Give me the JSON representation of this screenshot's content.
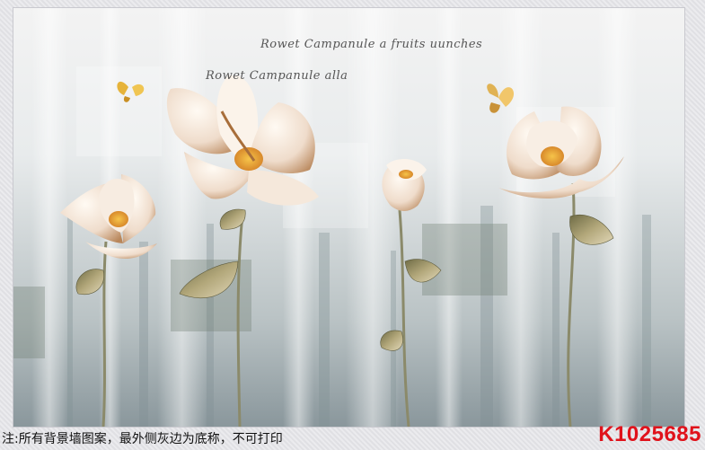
{
  "artwork": {
    "script_text_line1": "Rowet Campanule a fruits uunches",
    "script_text_line2": "Rowet Campanule alla"
  },
  "footer": {
    "note": "注:所有背景墙图案，最外侧灰边为底称，不可打印",
    "product_code": "K1025685"
  },
  "colors": {
    "brand_code": "#e0121b",
    "petal": "#f3e7dc",
    "stem": "#8a8a6a"
  }
}
